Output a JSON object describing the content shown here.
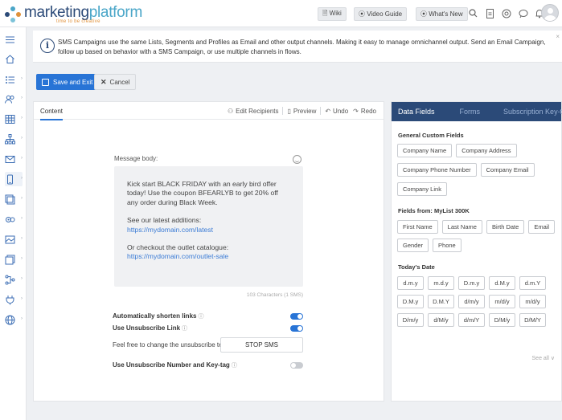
{
  "brand": {
    "name_a": "marketing",
    "name_b": "platform",
    "tagline": "time to be creative",
    "colors": {
      "navy": "#2b4a78",
      "teal": "#4aa6c8",
      "orange": "#e0913a",
      "accent": "#2874d6"
    }
  },
  "topbar": {
    "wiki": "🗎 Wiki",
    "video_guide": "⦿ Video Guide",
    "whats_new": "⦿ What's New",
    "icons": [
      "search-icon",
      "document-icon",
      "target-icon",
      "chat-icon",
      "bell-icon",
      "avatar"
    ]
  },
  "sidebar": {
    "items": [
      "menu-icon",
      "home-icon",
      "list-icon",
      "contacts-icon",
      "grid-icon",
      "sitemap-icon",
      "email-icon",
      "mobile-icon",
      "copy-icon",
      "automation-icon",
      "image-icon",
      "template-icon",
      "flow-icon",
      "plug-icon",
      "globe-icon"
    ]
  },
  "banner": {
    "text": "SMS Campaigns use the same Lists, Segments and Profiles as Email and other output channels. Making it easy to manage omnichannel output. Send an Email Campaign, follow up based on behavior with a SMS Campaign, or use multiple channels in flows.",
    "close": "×"
  },
  "actions": {
    "save": "Save and Exit",
    "cancel": "Cancel"
  },
  "editor": {
    "tab": "Content",
    "tools": {
      "edit_recipients": "Edit Recipients",
      "preview": "Preview",
      "undo": "Undo",
      "redo": "Redo"
    },
    "message_label": "Message body:",
    "message": {
      "p1": "Kick start BLACK FRIDAY with an early bird offer today! Use the coupon BFEARLYB to get 20% off any order during Black Week.",
      "p2": "See our latest additions:",
      "link1": "https://mydomain.com/latest",
      "p3": "Or checkout the outlet catalogue:",
      "link2": "https://mydomain.com/outlet-sale"
    },
    "char_count": "103 Characters (1 SMS)",
    "options": {
      "shorten_links": {
        "label": "Automatically shorten links",
        "enabled": true
      },
      "unsubscribe_link": {
        "label": "Use Unsubscribe Link",
        "enabled": true
      },
      "unsub_hint": "Feel free to change the unsubscribe text",
      "unsub_value": "STOP SMS",
      "unsub_number": {
        "label": "Use Unsubscribe Number and Key-tag",
        "enabled": false
      }
    }
  },
  "right_panel": {
    "tabs": [
      "Data Fields",
      "Forms",
      "Subscription Key-tag"
    ],
    "general_title": "General Custom Fields",
    "general_rows": [
      [
        "Company Name",
        "Company Address"
      ],
      [
        "Company Phone Number",
        "Company Email"
      ],
      [
        "Company Link"
      ]
    ],
    "list_title": "Fields from: MyList 300K",
    "list_rows": [
      [
        "First Name",
        "Last Name",
        "Birth Date",
        "Email"
      ],
      [
        "Gender",
        "Phone"
      ]
    ],
    "date_title": "Today's Date",
    "date_rows": [
      [
        "d.m.y",
        "m.d.y",
        "D.m.y",
        "d.M.y",
        "d.m.Y"
      ],
      [
        "D.M.y",
        "D.M.Y",
        "d/m/y",
        "m/d/y",
        "m/d/y"
      ],
      [
        "D/m/y",
        "d/M/y",
        "d/m/Y",
        "D/M/y",
        "D/M/Y"
      ]
    ],
    "see_all": "See all ∨"
  }
}
